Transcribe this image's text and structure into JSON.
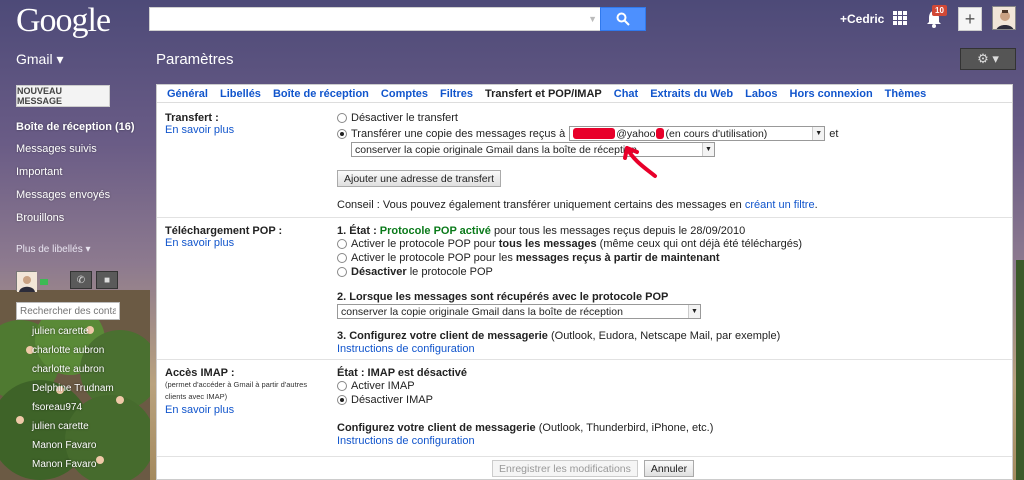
{
  "topbar": {
    "logo": "Google",
    "search_value": "",
    "user": "+Cedric",
    "notifications": "10"
  },
  "header": {
    "app": "Gmail ▾",
    "title": "Paramètres",
    "settings_icon": "gear-icon"
  },
  "sidebar": {
    "compose": "NOUVEAU MESSAGE",
    "items": [
      {
        "label": "Boîte de réception (16)",
        "bold": true
      },
      {
        "label": "Messages suivis"
      },
      {
        "label": "Important"
      },
      {
        "label": "Messages envoyés"
      },
      {
        "label": "Brouillons"
      }
    ],
    "more": "Plus de libellés ▾",
    "chat_search_placeholder": "Rechercher des contac",
    "contacts": [
      "julien carette",
      "charlotte aubron",
      "charlotte aubron",
      "Delphine Trudnam",
      "fsoreau974",
      "julien carette",
      "Manon Favaro",
      "Manon Favaro"
    ]
  },
  "tabs": [
    "Général",
    "Libellés",
    "Boîte de réception",
    "Comptes",
    "Filtres",
    "Transfert et POP/IMAP",
    "Chat",
    "Extraits du Web",
    "Labos",
    "Hors connexion",
    "Thèmes"
  ],
  "active_tab": "Transfert et POP/IMAP",
  "forwarding": {
    "title": "Transfert :",
    "learn_more": "En savoir plus",
    "disable": "Désactiver le transfert",
    "forward_prefix": "Transférer une copie des messages reçus à",
    "address_visible": "@yahoo",
    "in_use": "(en cours d'utilisation)",
    "and": "et",
    "keep_option": "conserver la copie originale Gmail dans la boîte de réception",
    "add_button": "Ajouter une adresse de transfert",
    "tip_prefix": "Conseil : Vous pouvez également transférer uniquement certains des messages en",
    "tip_link": "créant un filtre",
    "tip_suffix": "."
  },
  "pop": {
    "title": "Téléchargement POP :",
    "learn_more": "En savoir plus",
    "status_prefix": "1. État :",
    "status_value": "Protocole POP activé",
    "status_suffix": "pour tous les messages reçus depuis le 28/09/2010",
    "opt1_a": "Activer le protocole POP pour",
    "opt1_b": "tous les messages",
    "opt1_c": "(même ceux qui ont déjà été téléchargés)",
    "opt2_a": "Activer le protocole POP pour les",
    "opt2_b": "messages reçus à partir de maintenant",
    "opt3_a": "Désactiver",
    "opt3_b": "le protocole POP",
    "q2": "2. Lorsque les messages sont récupérés avec le protocole POP",
    "q2_value": "conserver la copie originale Gmail dans la boîte de réception",
    "q3": "3. Configurez votre client de messagerie",
    "q3_suffix": "(Outlook, Eudora, Netscape Mail, par exemple)",
    "instructions": "Instructions de configuration"
  },
  "imap": {
    "title": "Accès IMAP :",
    "note": "(permet d'accéder à Gmail à partir d'autres clients avec IMAP)",
    "learn_more": "En savoir plus",
    "status": "État : IMAP est désactivé",
    "enable": "Activer IMAP",
    "disable": "Désactiver IMAP",
    "configure": "Configurez votre client de messagerie",
    "configure_suffix": "(Outlook, Thunderbird, iPhone, etc.)",
    "instructions": "Instructions de configuration"
  },
  "footer": {
    "save": "Enregistrer les modifications",
    "cancel": "Annuler"
  },
  "colors": {
    "accent": "#4d90fe",
    "link": "#1155cc",
    "pop_active": "#0a7a1a",
    "redaction": "#e8002a"
  }
}
